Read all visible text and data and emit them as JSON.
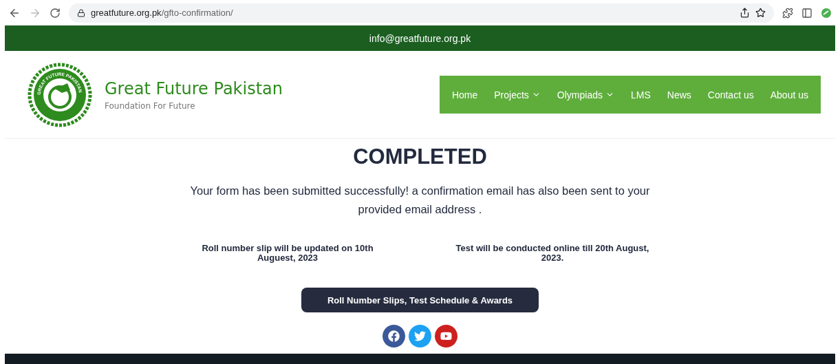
{
  "browser": {
    "url_host": "greatfuture.org.pk",
    "url_path": "/gfto-confirmation/"
  },
  "top_bar": {
    "email": "info@greatfuture.org.pk"
  },
  "header": {
    "logo_text": "GREAT FUTURE PAKISTAN",
    "title": "Great Future Pakistan",
    "tagline": "Foundation For Future",
    "nav": [
      {
        "label": "Home",
        "dropdown": false
      },
      {
        "label": "Projects",
        "dropdown": true
      },
      {
        "label": "Olympiads",
        "dropdown": true
      },
      {
        "label": "LMS",
        "dropdown": false
      },
      {
        "label": "News",
        "dropdown": false
      },
      {
        "label": "Contact us",
        "dropdown": false
      },
      {
        "label": "About us",
        "dropdown": false
      }
    ]
  },
  "main": {
    "heading": "COMPLETED",
    "message": "Your form has been submitted successfully! a confirmation email has also been sent to your provided email address .",
    "notes": [
      "Roll number slip will be updated on 10th Auguest, 2023",
      "Test will be conducted online till 20th August, 2023."
    ],
    "button": "Roll Number Slips, Test Schedule & Awards",
    "social": [
      {
        "kind": "facebook",
        "color": "#3b5998"
      },
      {
        "kind": "twitter",
        "color": "#1da1f2"
      },
      {
        "kind": "youtube",
        "color": "#cd201f"
      }
    ]
  }
}
